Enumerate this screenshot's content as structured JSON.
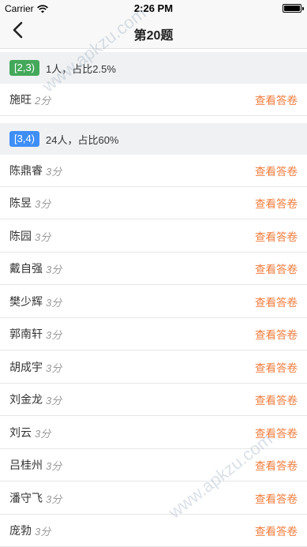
{
  "status_bar": {
    "carrier": "Carrier",
    "time": "2:26 PM"
  },
  "nav": {
    "title": "第20题"
  },
  "groups": [
    {
      "range": "[2,3)",
      "summary": "1人，占比2.5%",
      "students": [
        {
          "name": "施旺",
          "score": "2分",
          "action": "查看答卷"
        }
      ]
    },
    {
      "range": "[3,4)",
      "summary": "24人，占比60%",
      "students": [
        {
          "name": "陈鼎睿",
          "score": "3分",
          "action": "查看答卷"
        },
        {
          "name": "陈昱",
          "score": "3分",
          "action": "查看答卷"
        },
        {
          "name": "陈园",
          "score": "3分",
          "action": "查看答卷"
        },
        {
          "name": "戴自强",
          "score": "3分",
          "action": "查看答卷"
        },
        {
          "name": "樊少辉",
          "score": "3分",
          "action": "查看答卷"
        },
        {
          "name": "郭南轩",
          "score": "3分",
          "action": "查看答卷"
        },
        {
          "name": "胡成宇",
          "score": "3分",
          "action": "查看答卷"
        },
        {
          "name": "刘金龙",
          "score": "3分",
          "action": "查看答卷"
        },
        {
          "name": "刘云",
          "score": "3分",
          "action": "查看答卷"
        },
        {
          "name": "吕桂州",
          "score": "3分",
          "action": "查看答卷"
        },
        {
          "name": "潘守飞",
          "score": "3分",
          "action": "查看答卷"
        },
        {
          "name": "庞勃",
          "score": "3分",
          "action": "查看答卷"
        }
      ]
    }
  ],
  "watermarks": [
    "www.apkzu.com",
    "www.apkzu.com"
  ],
  "colors": {
    "accent": "#f07c3c",
    "tag_green": "#43a85a",
    "tag_blue": "#3e8ef7"
  },
  "icons": {
    "back": "chevron-left-icon",
    "wifi": "wifi-icon",
    "battery": "battery-icon"
  }
}
